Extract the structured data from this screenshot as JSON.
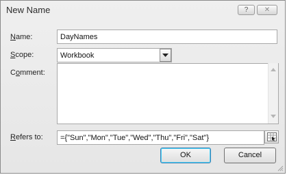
{
  "window": {
    "title": "New Name",
    "help_icon": "question-mark-icon",
    "help_glyph": "?",
    "close_icon": "close-icon",
    "close_glyph": "✕"
  },
  "fields": {
    "name": {
      "label_acc": "N",
      "label_rest": "ame:",
      "value": "DayNames"
    },
    "scope": {
      "label_acc": "S",
      "label_rest": "cope:",
      "value": "Workbook"
    },
    "comment": {
      "label_pre": "C",
      "label_acc": "o",
      "label_rest": "mment:",
      "value": ""
    },
    "refers_to": {
      "label_acc": "R",
      "label_rest": "efers to:",
      "value": "={\"Sun\",\"Mon\",\"Tue\",\"Wed\",\"Thu\",\"Fri\",\"Sat\"}",
      "icon": "collapse-dialog-icon"
    }
  },
  "buttons": {
    "ok": "OK",
    "cancel": "Cancel"
  },
  "colors": {
    "dialog_bg": "#e9e9e9",
    "ok_focus": "#3c7fb1"
  }
}
